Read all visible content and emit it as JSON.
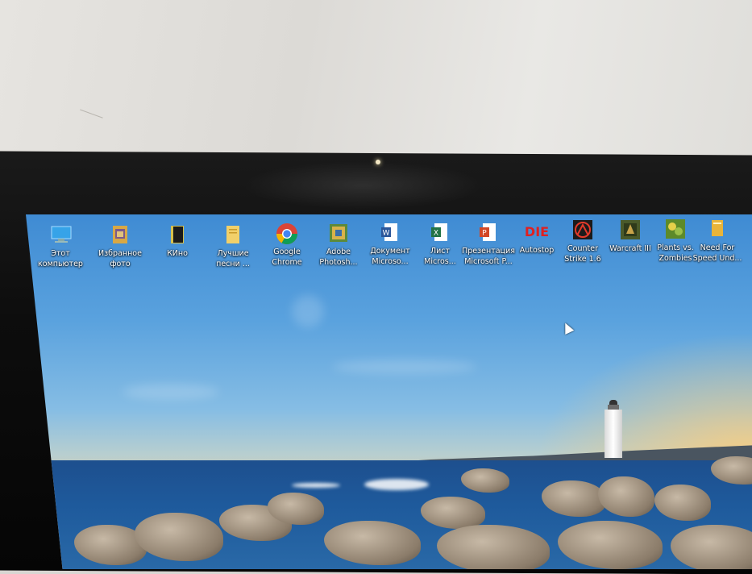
{
  "desktop": {
    "icons": [
      {
        "label_line1": "Этот",
        "label_line2": "компьютер",
        "icon": "this-pc-icon"
      },
      {
        "label_line1": "Избранное",
        "label_line2": "фото",
        "icon": "folder-photos-icon"
      },
      {
        "label_line1": "КИно",
        "label_line2": "",
        "icon": "folder-movies-icon"
      },
      {
        "label_line1": "Лучшие",
        "label_line2": "песни ...",
        "icon": "folder-songs-icon"
      },
      {
        "label_line1": "Google",
        "label_line2": "Chrome",
        "icon": "chrome-icon"
      },
      {
        "label_line1": "Adobe",
        "label_line2": "Photosh...",
        "icon": "photoshop-icon"
      },
      {
        "label_line1": "Документ",
        "label_line2": "Microso...",
        "icon": "word-doc-icon"
      },
      {
        "label_line1": "Лист",
        "label_line2": "Micros...",
        "icon": "excel-sheet-icon"
      },
      {
        "label_line1": "Презентация",
        "label_line2": "Microsoft P...",
        "icon": "powerpoint-icon"
      },
      {
        "label_line1": "Autostop",
        "label_line2": "",
        "icon": "autostop-game-icon"
      },
      {
        "label_line1": "Counter",
        "label_line2": "Strike 1.6",
        "icon": "counter-strike-icon"
      },
      {
        "label_line1": "Warcraft III",
        "label_line2": "",
        "icon": "warcraft-icon"
      },
      {
        "label_line1": "Plants vs.",
        "label_line2": "Zombies",
        "icon": "plants-vs-zombies-icon"
      },
      {
        "label_line1": "Need For",
        "label_line2": "Speed Und...",
        "icon": "need-for-speed-icon"
      }
    ]
  },
  "colors": {
    "sky_top": "#3f8bd3",
    "sea": "#1e5a9c",
    "label_text": "#ffffff"
  }
}
